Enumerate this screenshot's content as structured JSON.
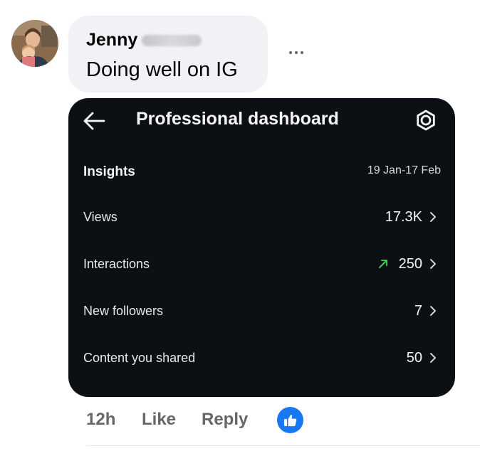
{
  "comment": {
    "author": "Jenny",
    "text": "Doing well on IG",
    "more_icon": "more-horizontal-icon"
  },
  "dashboard": {
    "title": "Professional dashboard",
    "back_icon": "arrow-left-icon",
    "settings_icon": "gear-icon",
    "insights": {
      "title": "Insights",
      "date_range": "19 Jan-17 Feb",
      "metrics": [
        {
          "label": "Views",
          "value": "17.3K"
        },
        {
          "label": "Interactions",
          "value": "250",
          "trend": "up",
          "trend_color": "#3ccf4e"
        },
        {
          "label": "New followers",
          "value": "7"
        },
        {
          "label": "Content you shared",
          "value": "50"
        }
      ]
    },
    "colors": {
      "background": "#0c0f14",
      "text": "#f5f5f5"
    }
  },
  "actions": {
    "time": "12h",
    "like": "Like",
    "reply": "Reply",
    "reaction_icon": "thumbs-up-icon",
    "reaction_color": "#1877f2"
  }
}
